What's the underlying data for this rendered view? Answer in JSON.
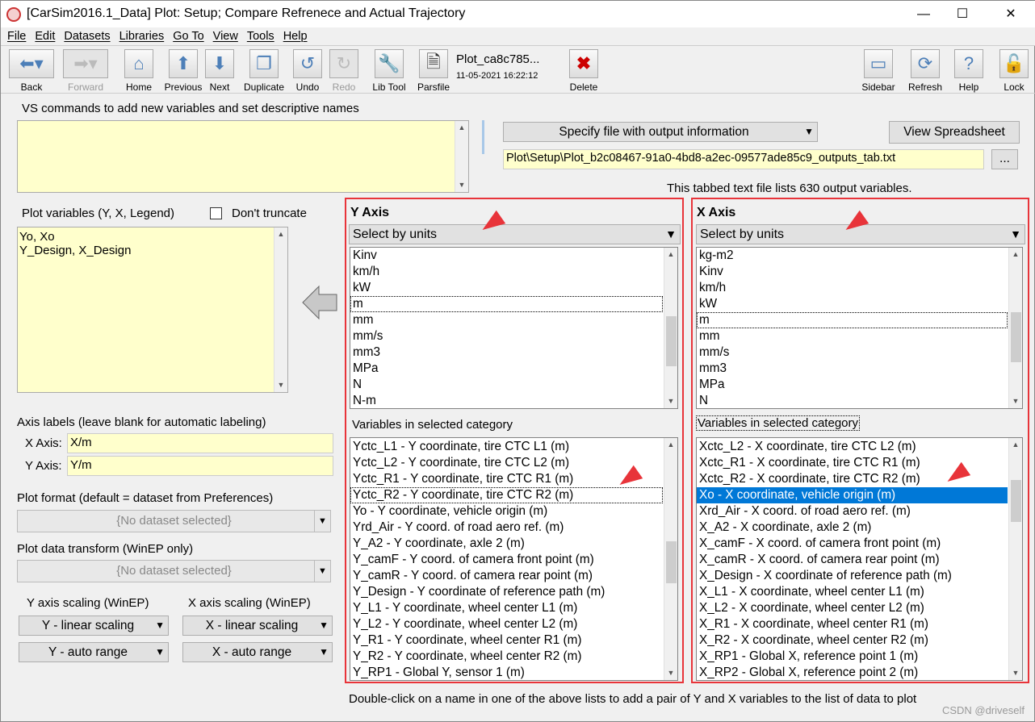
{
  "window": {
    "title": "[CarSim2016.1_Data] Plot: Setup; Compare Refrenece and Actual Trajectory",
    "minimize": "—",
    "maximize": "☐",
    "close": "✕"
  },
  "menu": [
    "File",
    "Edit",
    "Datasets",
    "Libraries",
    "Go To",
    "View",
    "Tools",
    "Help"
  ],
  "toolbar": {
    "back": "Back",
    "forward": "Forward",
    "home": "Home",
    "previous": "Previous",
    "next": "Next",
    "duplicate": "Duplicate",
    "undo": "Undo",
    "redo": "Redo",
    "libtool": "Lib Tool",
    "parsfile": "Parsfile",
    "dataset_name": "Plot_ca8c785...",
    "dataset_time": "11-05-2021 16:22:12",
    "delete": "Delete",
    "sidebar": "Sidebar",
    "refresh": "Refresh",
    "help": "Help",
    "lock": "Lock"
  },
  "left": {
    "vs_label": "VS commands to add new variables and set descriptive names",
    "vs_value": "",
    "plotvars_label": "Plot variables  (Y, X, Legend)",
    "dont_truncate": "Don't truncate",
    "plotvars": [
      "Yo, Xo",
      "Y_Design, X_Design"
    ],
    "axis_labels_title": "Axis labels (leave blank for automatic labeling)",
    "x_axis_label": "X Axis:",
    "x_axis_value": "X/m",
    "y_axis_label": "Y Axis:",
    "y_axis_value": "Y/m",
    "plot_format_label": "Plot format (default = dataset from Preferences)",
    "plot_format_value": "{No dataset selected}",
    "transform_label": "Plot data transform (WinEP only)",
    "transform_value": "{No dataset selected}",
    "y_scaling_label": "Y axis scaling (WinEP)",
    "x_scaling_label": "X axis scaling (WinEP)",
    "y_scaling": "Y - linear scaling",
    "y_range": "Y - auto range",
    "x_scaling": "X - linear scaling",
    "x_range": "X - auto range"
  },
  "output": {
    "specify": "Specify file with output information",
    "view_spreadsheet": "View Spreadsheet",
    "path": "Plot\\Setup\\Plot_b2c08467-91a0-4bd8-a2ec-09577ade85c9_outputs_tab.txt",
    "browse": "...",
    "info": "This tabbed text file lists 630 output variables."
  },
  "y_axis": {
    "title": "Y Axis",
    "select": "Select by units",
    "units": [
      "Kinv",
      "km/h",
      "kW",
      "m",
      "mm",
      "mm/s",
      "mm3",
      "MPa",
      "N",
      "N-m"
    ],
    "units_focus": 3,
    "vars_label": "Variables in selected category",
    "vars": [
      "Yctc_L1 - Y coordinate, tire CTC L1 (m)",
      "Yctc_L2 - Y coordinate, tire CTC L2 (m)",
      "Yctc_R1 - Y coordinate, tire CTC R1 (m)",
      "Yctc_R2 - Y coordinate, tire CTC R2 (m)",
      "Yo - Y coordinate, vehicle origin (m)",
      "Yrd_Air - Y coord. of road aero ref. (m)",
      "Y_A2 - Y coordinate, axle 2 (m)",
      "Y_camF - Y coord. of camera front point (m)",
      "Y_camR - Y coord. of camera rear point (m)",
      "Y_Design - Y coordinate of reference path (m)",
      "Y_L1 - Y coordinate, wheel center L1 (m)",
      "Y_L2 - Y coordinate, wheel center L2 (m)",
      "Y_R1 - Y coordinate, wheel center R1 (m)",
      "Y_R2 - Y coordinate, wheel center R2 (m)",
      "Y_RP1 - Global Y, sensor 1 (m)"
    ],
    "vars_focus": 3,
    "vars_selected": -1
  },
  "x_axis": {
    "title": "X Axis",
    "select": "Select by units",
    "units": [
      "kg-m2",
      "Kinv",
      "km/h",
      "kW",
      "m",
      "mm",
      "mm/s",
      "mm3",
      "MPa",
      "N"
    ],
    "units_focus": 4,
    "vars_label": "Variables in selected category",
    "vars": [
      "Xctc_L2 - X coordinate, tire CTC L2 (m)",
      "Xctc_R1 - X coordinate, tire CTC R1 (m)",
      "Xctc_R2 - X coordinate, tire CTC R2 (m)",
      "Xo - X coordinate, vehicle origin (m)",
      "Xrd_Air - X coord. of road aero ref. (m)",
      "X_A2 - X coordinate, axle 2 (m)",
      "X_camF - X coord. of camera front point (m)",
      "X_camR - X coord. of camera rear point (m)",
      "X_Design - X coordinate of reference path (m)",
      "X_L1 - X coordinate, wheel center L1 (m)",
      "X_L2 - X coordinate, wheel center L2 (m)",
      "X_R1 - X coordinate, wheel center R1 (m)",
      "X_R2 - X coordinate, wheel center R2 (m)",
      "X_RP1 - Global X, reference point 1 (m)",
      "X_RP2 - Global X, reference point 2 (m)"
    ],
    "vars_focus": -1,
    "vars_selected": 3
  },
  "hint": "Double-click on a name in one of the above lists to add a pair of Y and X variables to the list of  data to plot",
  "watermark": "CSDN @driveself",
  "colors": {
    "highlight": "#0078d7",
    "annotation_red": "#e8343a",
    "field_yellow": "#ffffcc"
  }
}
